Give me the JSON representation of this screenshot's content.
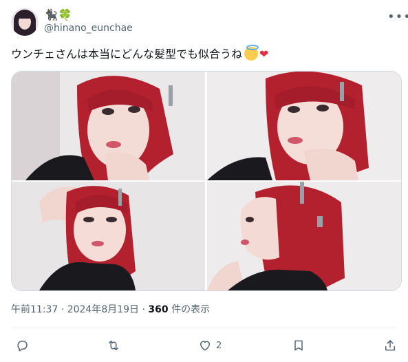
{
  "author": {
    "display_name": "🐈‍⬛🍀",
    "handle": "@hinano_eunchae"
  },
  "tweet": {
    "text": "ウンチェさんは本当にどんな髪型でも似合うね",
    "emojis": [
      "smiling-face-with-halo",
      "red-heart"
    ]
  },
  "media": {
    "photos": [
      {
        "name": "photo-1"
      },
      {
        "name": "photo-2"
      },
      {
        "name": "photo-3"
      },
      {
        "name": "photo-4"
      }
    ]
  },
  "meta": {
    "timestamp": "午前11:37 · 2024年8月19日 · ",
    "views_count": "360",
    "views_label": " 件の表示"
  },
  "actions": {
    "like_count": "2"
  },
  "colors": {
    "text": "#0f1419",
    "secondary": "#536471",
    "border": "#cfd9de",
    "hair": "#b3202e",
    "heart": "#dd2e44"
  }
}
